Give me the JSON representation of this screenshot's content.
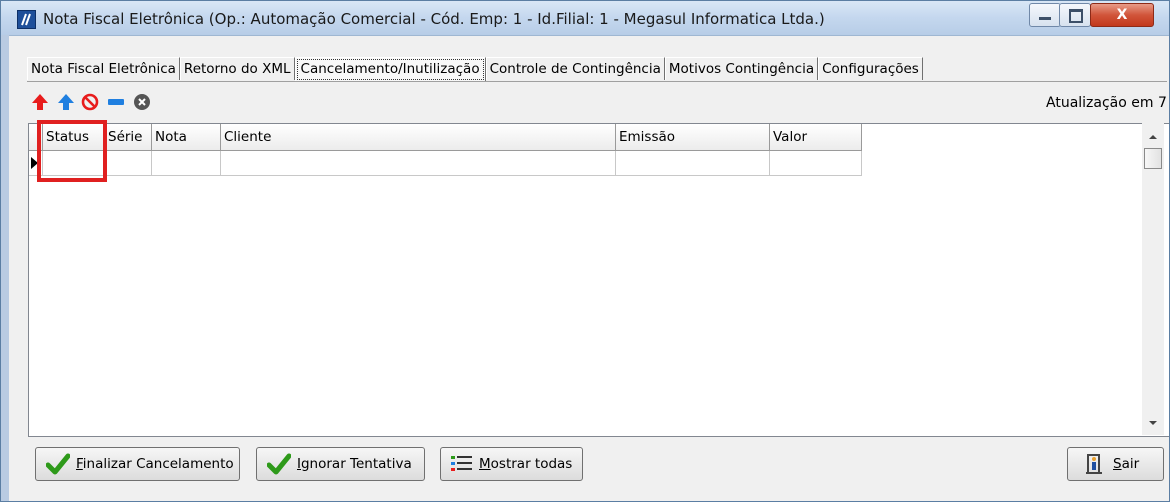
{
  "window": {
    "title": "Nota Fiscal Eletrônica (Op.: Automação Comercial - Cód. Emp: 1 - Id.Filial: 1 - Megasul Informatica Ltda.)",
    "minimize_label": "",
    "maximize_label": "",
    "close_label": "X"
  },
  "tabs": [
    {
      "label": "Nota Fiscal Eletrônica"
    },
    {
      "label": "Retorno do XML"
    },
    {
      "label": "Cancelamento/Inutilização"
    },
    {
      "label": "Controle de Contingência"
    },
    {
      "label": "Motivos Contingência"
    },
    {
      "label": "Configurações"
    }
  ],
  "toolbar": {
    "icons": [
      "arrow-up-red-icon",
      "arrow-up-blue-icon",
      "no-entry-icon",
      "minus-icon",
      "close-circle-icon"
    ],
    "refresh_text": "Atualização em 7"
  },
  "grid": {
    "columns": [
      "Status",
      "Série",
      "Nota",
      "Cliente",
      "Emissão",
      "Valor"
    ],
    "rows": [
      [
        "",
        "",
        "",
        "",
        "",
        ""
      ]
    ]
  },
  "buttons": {
    "finalize": {
      "mnemonic": "F",
      "rest": "inalizar Cancelamento"
    },
    "ignore": {
      "mnemonic": "I",
      "rest": "gnorar Tentativa"
    },
    "show_all": {
      "mnemonic": "M",
      "rest": "ostrar todas"
    },
    "exit": {
      "mnemonic": "S",
      "rest": "air"
    }
  },
  "colors": {
    "highlight": "#e02020",
    "check": "#2e9a1a",
    "arrow_red": "#e81c1c",
    "arrow_blue": "#1f7fe0"
  }
}
